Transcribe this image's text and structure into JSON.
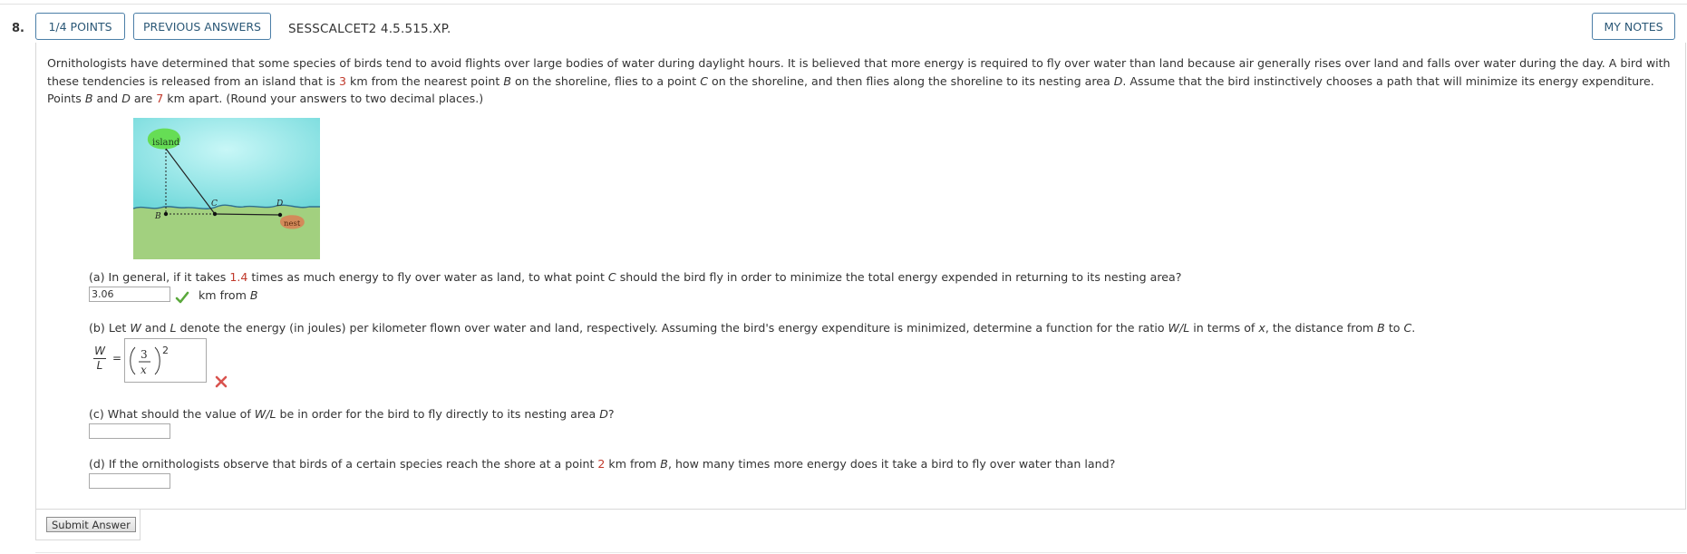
{
  "question": {
    "number": "8.",
    "points_label": "1/4 POINTS",
    "previous_answers_label": "PREVIOUS ANSWERS",
    "code": "SESSCALCET2 4.5.515.XP.",
    "my_notes_label": "MY NOTES"
  },
  "intro": {
    "t1": "Ornithologists have determined that some species of birds tend to avoid flights over large bodies of water during daylight hours. It is believed that more energy is required to fly over water than land because air generally rises over land and falls over water during the day. A bird with these tendencies is released from an island that is ",
    "dist_island": "3",
    "t2": " km from the nearest point ",
    "B": "B",
    "t3": " on the shoreline, flies to a point ",
    "C": "C",
    "t4": " on the shoreline, and then flies along the shoreline to its nesting area ",
    "D": "D",
    "t5": ". Assume that the bird instinctively chooses a path that will minimize its energy expenditure. Points ",
    "t6": " and ",
    "t7": " are ",
    "dist_BD": "7",
    "t8": " km apart. (Round your answers to two decimal places.)"
  },
  "figure": {
    "island_label": "island",
    "label_B": "B",
    "label_C": "C",
    "label_D": "D",
    "nest_label": "nest",
    "colors": {
      "water": "#8fe4e4",
      "land": "#9fcf7f",
      "island": "#66dd55",
      "nest": "#d38a5a"
    }
  },
  "part_a": {
    "q1": "(a) In general, if it takes ",
    "factor": "1.4",
    "q2": " times as much energy to fly over water as land, to what point ",
    "C": "C",
    "q3": " should the bird fly in order to minimize the total energy expended in returning to its nesting area?",
    "answer_value": "3.06",
    "units_prefix": "km from ",
    "units_B": "B",
    "status": "correct"
  },
  "part_b": {
    "q1": "(b) Let ",
    "W": "W",
    "q2": " and ",
    "L": "L",
    "q3": " denote the energy (in joules) per kilometer flown over water and land, respectively. Assuming the bird's energy expenditure is minimized, determine a function for the ratio ",
    "ratio": "W/L",
    "q4": " in terms of ",
    "x": "x",
    "q5": ", the distance from ",
    "B": "B",
    "q6": " to ",
    "C": "C",
    "q7": ".",
    "lhs_num": "W",
    "lhs_den": "L",
    "eq": "=",
    "answer_num": "3",
    "answer_den": "x",
    "answer_exp": "2",
    "status": "incorrect"
  },
  "part_c": {
    "q1": "(c) What should the value of ",
    "ratio": "W/L",
    "q2": " be in order for the bird to fly directly to its nesting area ",
    "D": "D",
    "q3": "?",
    "answer_value": ""
  },
  "part_d": {
    "q1": "(d) If the ornithologists observe that birds of a certain species reach the shore at a point ",
    "dist": "2",
    "q2": " km from ",
    "B": "B",
    "q3": ", how many times more energy does it take a bird to fly over water than land?",
    "answer_value": ""
  },
  "submit_label": "Submit Answer"
}
